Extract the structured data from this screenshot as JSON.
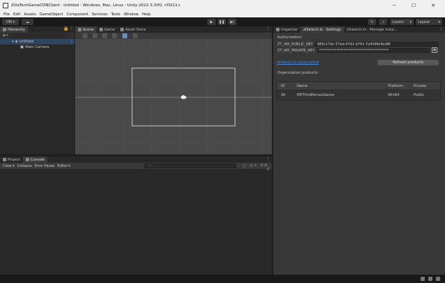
{
  "window": {
    "title": "ZillaTechGameCDNClient - Untitled - Windows, Mac, Linux - Unity 2022.3.20f1 <DX11>",
    "minimize": "─",
    "maximize": "☐",
    "close": "✕"
  },
  "menu": [
    "File",
    "Edit",
    "Assets",
    "GameObject",
    "Component",
    "Services",
    "Tools",
    "Window",
    "Help"
  ],
  "toolbar": {
    "account": "OM",
    "layers": "Layers",
    "layout": "Layout"
  },
  "hierarchy": {
    "tab": "Hierarchy",
    "scene": "Untitled",
    "object": "Main Camera"
  },
  "scene_tabs": [
    "Scene",
    "Game",
    "Asset Store"
  ],
  "bottom_tabs": [
    "Project",
    "Console"
  ],
  "console": {
    "clear": "Clear",
    "collapse": "Collapse",
    "error_pause": "Error Pause",
    "editor": "Editor",
    "count_info": "0",
    "count_warn": "0",
    "count_error": "0"
  },
  "inspector": {
    "tabs": [
      "Inspector",
      "zillatech.io - Settings",
      "zillatech.io - Manage insta..."
    ],
    "auth_title": "Authorization",
    "public_key_label": "ZT_API_PUBLIC_KEY",
    "public_key_value": "985c17dc-57ed-4791-b741-7a5096c6cd8f",
    "private_key_label": "ZT_API_PRIVATE_KEY",
    "private_key_value": "****************************************",
    "portal_link": "zillatech.io cloud portal",
    "refresh_button": "Refresh products",
    "org_products": "Organization products:",
    "columns": [
      "ID",
      "Name",
      "Platform",
      "Private"
    ],
    "rows": [
      {
        "id": "40",
        "name": "MPThirdPersonGame",
        "platform": "Win64",
        "private": "Public"
      }
    ]
  }
}
